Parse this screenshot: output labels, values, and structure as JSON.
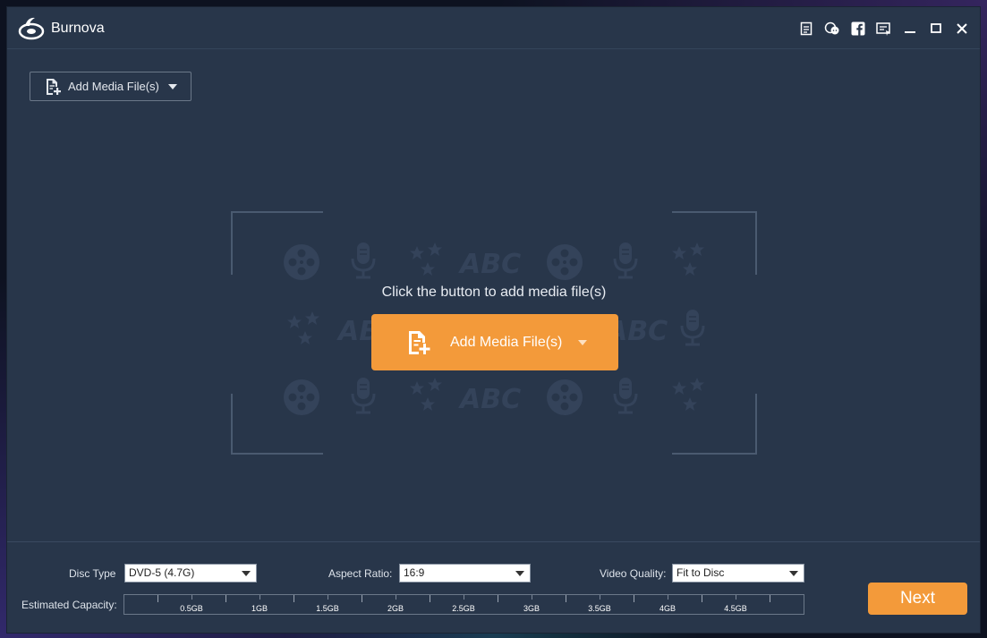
{
  "app": {
    "title": "Burnova"
  },
  "toolbar": {
    "add_media_label": "Add Media File(s)",
    "icons": [
      "register-icon",
      "feedback-chat-icon",
      "facebook-icon",
      "menu-icon",
      "minimize-icon",
      "maximize-icon",
      "close-icon"
    ]
  },
  "dropzone": {
    "hint": "Click the button to add media file(s)",
    "button_label": "Add Media File(s)",
    "deco_text": "ABC"
  },
  "bottom": {
    "disc_type_label": "Disc Type",
    "disc_type_value": "DVD-5 (4.7G)",
    "aspect_ratio_label": "Aspect Ratio:",
    "aspect_ratio_value": "16:9",
    "video_quality_label": "Video Quality:",
    "video_quality_value": "Fit to Disc",
    "capacity_label": "Estimated Capacity:",
    "capacity_ticks": [
      "0.5GB",
      "1GB",
      "1.5GB",
      "2GB",
      "2.5GB",
      "3GB",
      "3.5GB",
      "4GB",
      "4.5GB"
    ],
    "next_label": "Next"
  },
  "colors": {
    "window_bg": "#28364a",
    "accent_orange": "#f39a3a",
    "decor": "#34435a"
  }
}
